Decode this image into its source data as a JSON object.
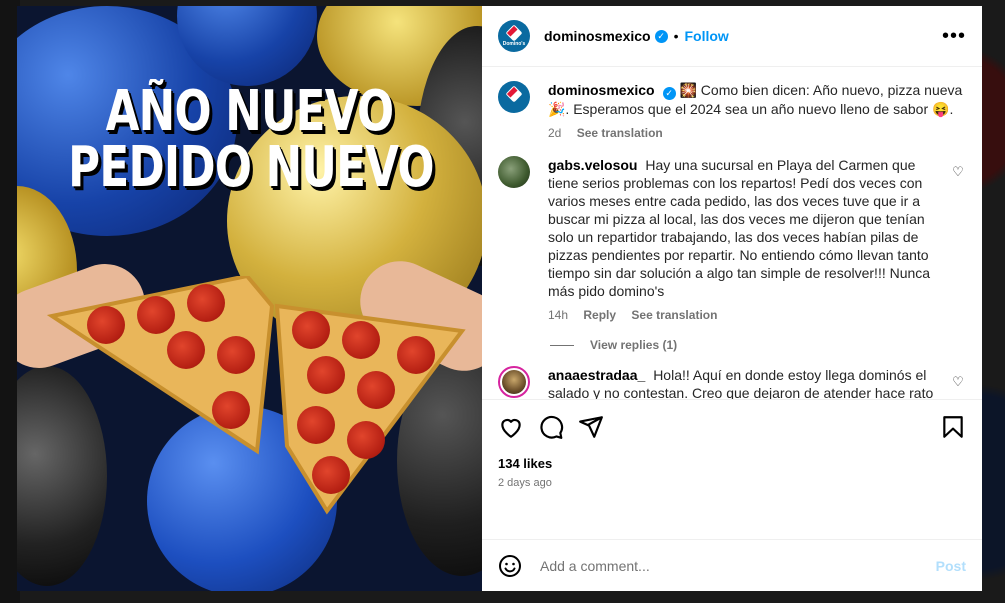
{
  "post": {
    "image_text": {
      "line1": "AÑO NUEVO",
      "line2": "PEDIDO NUEVO"
    },
    "header": {
      "username": "dominosmexico",
      "separator": "•",
      "follow_label": "Follow",
      "more_label": "•••",
      "avatar_text": "Domino's"
    },
    "caption": {
      "username": "dominosmexico",
      "text": "🎇 Como bien dicen: Año nuevo, pizza nueva 🎉. Esperamos que el 2024 sea un año nuevo lleno de sabor 😝.",
      "time": "2d",
      "translate_label": "See translation"
    },
    "comments": [
      {
        "username": "gabs.velosou",
        "text": "Hay una sucursal en Playa del Carmen que tiene serios problemas con los repartos! Pedí dos veces con varios meses entre cada pedido, las dos veces tuve que ir a buscar mi pizza al local, las dos veces me dijeron que tenían solo un repartidor trabajando, las dos veces habían pilas de pizzas pendientes por repartir. No entiendo cómo llevan tanto tiempo sin dar solución a algo tan simple de resolver!!! Nunca más pido domino's",
        "time": "14h",
        "reply_label": "Reply",
        "translate_label": "See translation",
        "view_replies_label": "View replies (1)"
      },
      {
        "username": "anaaestradaa_",
        "text": "Hola!! Aquí en donde estoy llega dominós el salado y no contestan. Creo que dejaron de atender hace rato"
      }
    ],
    "likes_label": "134 likes",
    "date_label": "2 days ago",
    "comment_input": {
      "placeholder": "Add a comment...",
      "post_label": "Post"
    }
  },
  "colors": {
    "accent": "#0095f6",
    "post_disabled": "#b2dffc",
    "muted": "#737373"
  }
}
